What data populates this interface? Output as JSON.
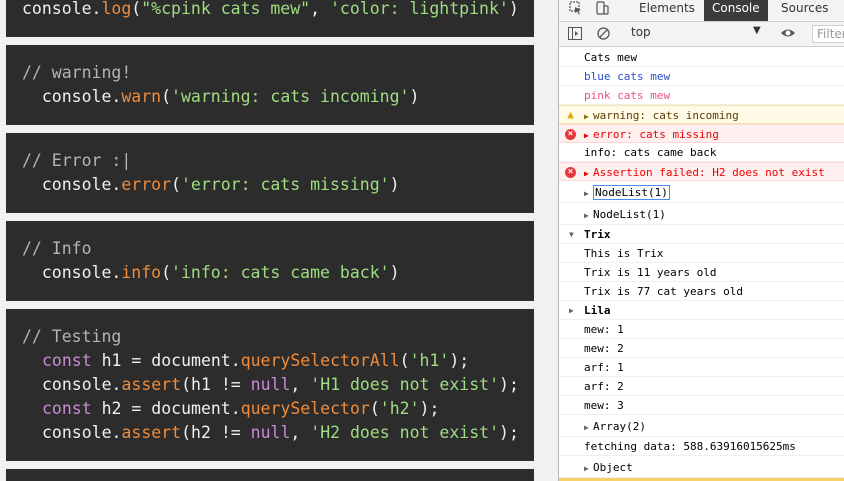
{
  "code": {
    "block1": {
      "line1": {
        "indent": "  ",
        "obj": "console",
        "dot": ".",
        "method": "log",
        "open": "(",
        "str1": "\"%cpink cats mew\"",
        "comma": ", ",
        "str2": "'color: lightpink'",
        "close": ")"
      }
    },
    "block2": {
      "comment": "// warning!",
      "line": {
        "indent": "  ",
        "obj": "console",
        "dot": ".",
        "method": "warn",
        "open": "(",
        "str": "'warning: cats incoming'",
        "close": ")"
      }
    },
    "block3": {
      "comment": "// Error :|",
      "line": {
        "indent": "  ",
        "obj": "console",
        "dot": ".",
        "method": "error",
        "open": "(",
        "str": "'error: cats missing'",
        "close": ")"
      }
    },
    "block4": {
      "comment": "// Info",
      "line": {
        "indent": "  ",
        "obj": "console",
        "dot": ".",
        "method": "info",
        "open": "(",
        "str": "'info: cats came back'",
        "close": ")"
      }
    },
    "block5": {
      "comment": "// Testing",
      "l1": {
        "kw": "const",
        "rest1": " h1 = document.",
        "method": "querySelectorAll",
        "open": "(",
        "str": "'h1'",
        "close": ");"
      },
      "l2": {
        "obj": "console.",
        "method": "assert",
        "rest1": "(h1 != ",
        "kw": "null",
        "comma": ", ",
        "str": "'H1 does not exist'",
        "close": ");"
      },
      "l3": {
        "kw": "const",
        "rest1": " h2 = document.",
        "method": "querySelector",
        "open": "(",
        "str": "'h2'",
        "close": ");"
      },
      "l4": {
        "obj": "console.",
        "method": "assert",
        "rest1": "(h2 != ",
        "kw": "null",
        "comma": ", ",
        "str": "'H2 does not exist'",
        "close": ");"
      }
    }
  },
  "devtools": {
    "tabs": {
      "elements": "Elements",
      "console": "Console",
      "sources": "Sources"
    },
    "context": "top",
    "filter_placeholder": "Filter",
    "rows": [
      {
        "text": "Cats mew"
      },
      {
        "text": "blue cats mew"
      },
      {
        "text": "pink cats mew"
      },
      {
        "text": "warning: cats incoming"
      },
      {
        "text": "error: cats missing"
      },
      {
        "text": "info: cats came back"
      },
      {
        "text": "Assertion failed: H2 does not exist"
      },
      {
        "text": "NodeList(1)"
      },
      {
        "text": "NodeList(1)"
      },
      {
        "text": "Trix"
      },
      {
        "text": "This is Trix"
      },
      {
        "text": "Trix is 11 years old"
      },
      {
        "text": "Trix is 77 cat years old"
      },
      {
        "text": "Lila"
      },
      {
        "text": "mew: 1"
      },
      {
        "text": "mew: 2"
      },
      {
        "text": "arf: 1"
      },
      {
        "text": "arf: 2"
      },
      {
        "text": "mew: 3"
      },
      {
        "text": "Array(2)"
      },
      {
        "text": "fetching data: 588.63916015625ms"
      },
      {
        "text": "Object"
      }
    ],
    "colors": {
      "blue_text": "#2a4cd0",
      "pink_text": "#e7508f",
      "error_text": "#e00000",
      "warning_icon": "#e6a700"
    }
  }
}
